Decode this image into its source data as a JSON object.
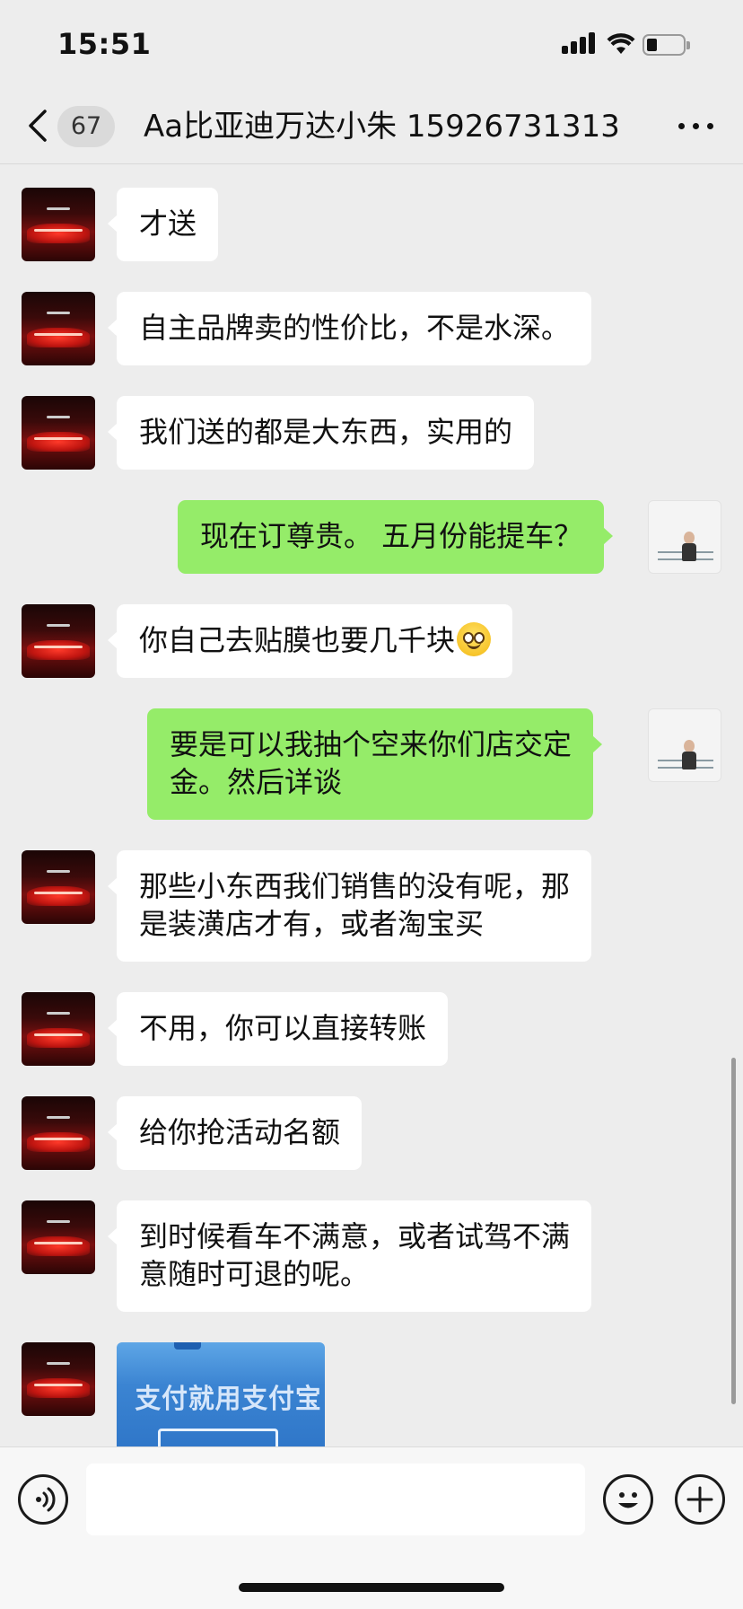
{
  "status_bar": {
    "time": "15:51"
  },
  "header": {
    "unread_count": "67",
    "title": "Aa比亚迪万达小朱 15926731313"
  },
  "messages": [
    {
      "side": "left",
      "text": "才送"
    },
    {
      "side": "left",
      "text": "自主品牌卖的性价比，不是水深。"
    },
    {
      "side": "left",
      "text": "我们送的都是大东西，实用的"
    },
    {
      "side": "right",
      "text": "现在订尊贵。 五月份能提车？"
    },
    {
      "side": "left",
      "text": "你自己去贴膜也要几千块",
      "emoji": "smile-emoji"
    },
    {
      "side": "right",
      "lines": [
        "要是可以我抽个空来你们店交定",
        "金。然后详谈"
      ]
    },
    {
      "side": "left",
      "lines": [
        "那些小东西我们销售的没有呢，那",
        "是装潢店才有，或者淘宝买"
      ]
    },
    {
      "side": "left",
      "text": "不用，你可以直接转账"
    },
    {
      "side": "left",
      "text": "给你抢活动名额"
    },
    {
      "side": "left",
      "lines": [
        "到时候看车不满意，或者试驾不满",
        "意随时可退的呢。"
      ]
    },
    {
      "side": "left",
      "type": "image",
      "image_text": "支付就用支付宝"
    }
  ],
  "input": {
    "placeholder": ""
  },
  "icons": {
    "back": "chevron-left-icon",
    "more": "more-dots-icon",
    "voice": "voice-icon",
    "emoji": "emoji-icon",
    "plus": "plus-icon"
  },
  "colors": {
    "background": "#ededed",
    "sent_bubble": "#95ec69",
    "received_bubble": "#ffffff"
  }
}
